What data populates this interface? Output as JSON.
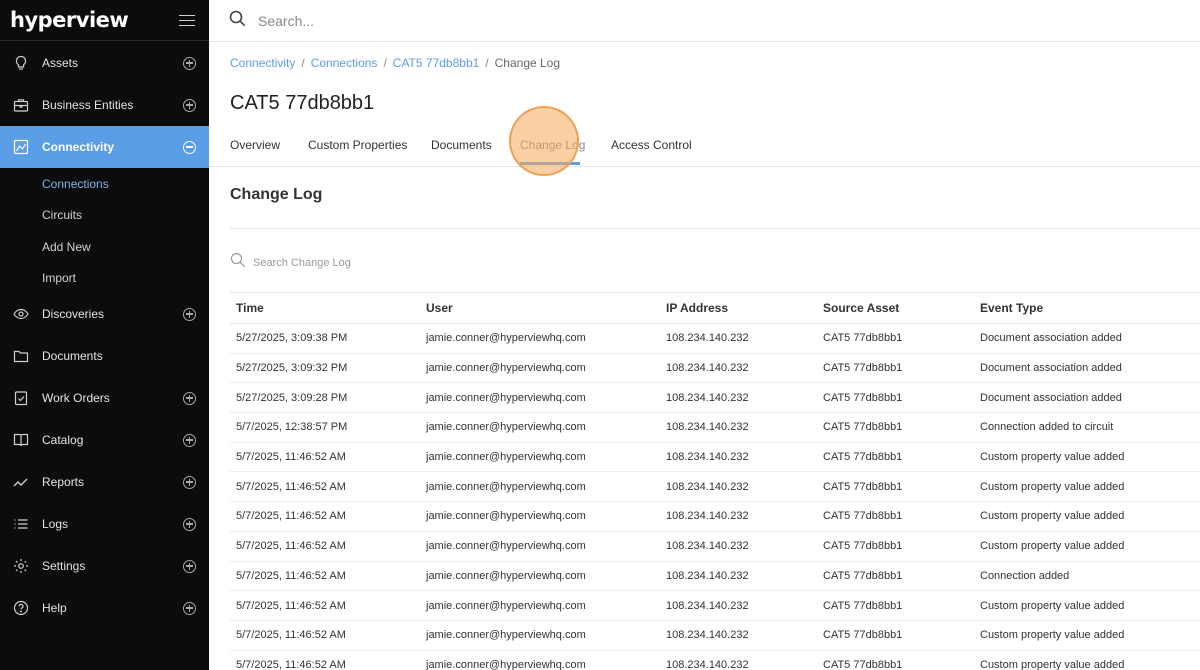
{
  "brand": {
    "logo": "hyperview"
  },
  "sidebar": {
    "items": [
      {
        "key": "assets",
        "label": "Assets",
        "icon": "lightbulb-icon",
        "action": "plus"
      },
      {
        "key": "business-entities",
        "label": "Business Entities",
        "icon": "briefcase-icon",
        "action": "plus"
      },
      {
        "key": "connectivity",
        "label": "Connectivity",
        "icon": "network-icon",
        "action": "minus",
        "active": true
      },
      {
        "key": "discoveries",
        "label": "Discoveries",
        "icon": "eye-icon",
        "action": "plus"
      },
      {
        "key": "documents",
        "label": "Documents",
        "icon": "folder-icon",
        "action": "none"
      },
      {
        "key": "work-orders",
        "label": "Work Orders",
        "icon": "clipboard-check-icon",
        "action": "plus"
      },
      {
        "key": "catalog",
        "label": "Catalog",
        "icon": "book-icon",
        "action": "plus"
      },
      {
        "key": "reports",
        "label": "Reports",
        "icon": "trend-line-icon",
        "action": "plus"
      },
      {
        "key": "logs",
        "label": "Logs",
        "icon": "list-icon",
        "action": "plus"
      },
      {
        "key": "settings",
        "label": "Settings",
        "icon": "gear-icon",
        "action": "plus"
      },
      {
        "key": "help",
        "label": "Help",
        "icon": "help-circle-icon",
        "action": "plus"
      }
    ],
    "subitems": [
      {
        "label": "Connections",
        "active": true
      },
      {
        "label": "Circuits"
      },
      {
        "label": "Add New"
      },
      {
        "label": "Import"
      }
    ]
  },
  "search": {
    "placeholder": "Search..."
  },
  "breadcrumb": {
    "items": [
      "Connectivity",
      "Connections",
      "CAT5 77db8bb1"
    ],
    "current": "Change Log",
    "separator": "/"
  },
  "page": {
    "title": "CAT5 77db8bb1"
  },
  "tabs": [
    {
      "label": "Overview"
    },
    {
      "label": "Custom Properties"
    },
    {
      "label": "Documents"
    },
    {
      "label": "Change Log",
      "active": true
    },
    {
      "label": "Access Control"
    }
  ],
  "section": {
    "title": "Change Log",
    "search_placeholder": "Search Change Log"
  },
  "table": {
    "columns": [
      "Time",
      "User",
      "IP Address",
      "Source Asset",
      "Event Type"
    ],
    "rows": [
      [
        "5/27/2025, 3:09:38 PM",
        "jamie.conner@hyperviewhq.com",
        "108.234.140.232",
        "CAT5 77db8bb1",
        "Document association added"
      ],
      [
        "5/27/2025, 3:09:32 PM",
        "jamie.conner@hyperviewhq.com",
        "108.234.140.232",
        "CAT5 77db8bb1",
        "Document association added"
      ],
      [
        "5/27/2025, 3:09:28 PM",
        "jamie.conner@hyperviewhq.com",
        "108.234.140.232",
        "CAT5 77db8bb1",
        "Document association added"
      ],
      [
        "5/7/2025, 12:38:57 PM",
        "jamie.conner@hyperviewhq.com",
        "108.234.140.232",
        "CAT5 77db8bb1",
        "Connection added to circuit"
      ],
      [
        "5/7/2025, 11:46:52 AM",
        "jamie.conner@hyperviewhq.com",
        "108.234.140.232",
        "CAT5 77db8bb1",
        "Custom property value added"
      ],
      [
        "5/7/2025, 11:46:52 AM",
        "jamie.conner@hyperviewhq.com",
        "108.234.140.232",
        "CAT5 77db8bb1",
        "Custom property value added"
      ],
      [
        "5/7/2025, 11:46:52 AM",
        "jamie.conner@hyperviewhq.com",
        "108.234.140.232",
        "CAT5 77db8bb1",
        "Custom property value added"
      ],
      [
        "5/7/2025, 11:46:52 AM",
        "jamie.conner@hyperviewhq.com",
        "108.234.140.232",
        "CAT5 77db8bb1",
        "Custom property value added"
      ],
      [
        "5/7/2025, 11:46:52 AM",
        "jamie.conner@hyperviewhq.com",
        "108.234.140.232",
        "CAT5 77db8bb1",
        "Connection added"
      ],
      [
        "5/7/2025, 11:46:52 AM",
        "jamie.conner@hyperviewhq.com",
        "108.234.140.232",
        "CAT5 77db8bb1",
        "Custom property value added"
      ],
      [
        "5/7/2025, 11:46:52 AM",
        "jamie.conner@hyperviewhq.com",
        "108.234.140.232",
        "CAT5 77db8bb1",
        "Custom property value added"
      ],
      [
        "5/7/2025, 11:46:52 AM",
        "jamie.conner@hyperviewhq.com",
        "108.234.140.232",
        "CAT5 77db8bb1",
        "Custom property value added"
      ]
    ]
  },
  "colors": {
    "accent": "#5b9ee8",
    "sidebar_bg": "#0c0c0c",
    "highlight": "#f7a85a"
  }
}
